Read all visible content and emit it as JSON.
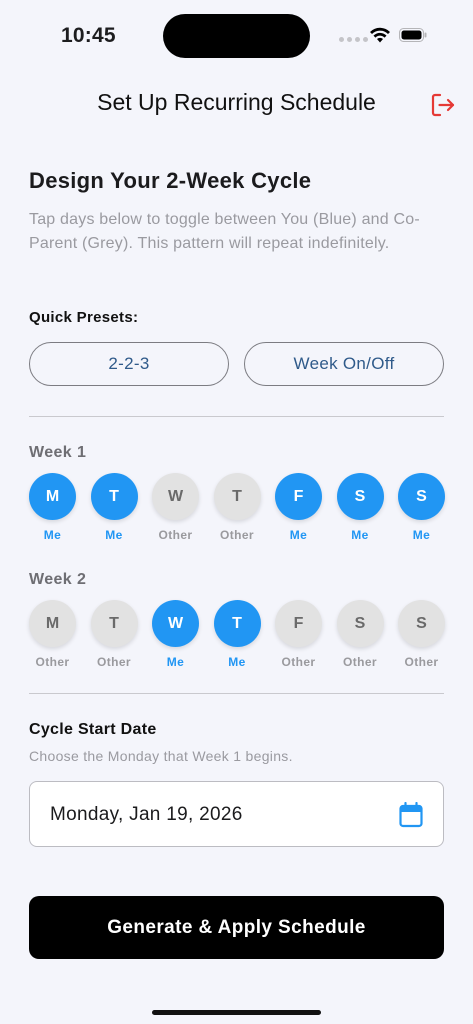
{
  "status_bar": {
    "time": "10:45"
  },
  "nav": {
    "title": "Set Up Recurring Schedule",
    "logout_icon": "logout-icon"
  },
  "intro": {
    "heading": "Design Your 2-Week Cycle",
    "description": "Tap days below to toggle between You (Blue) and Co-Parent (Grey). This pattern will repeat indefinitely."
  },
  "presets": {
    "label": "Quick Presets:",
    "options": [
      "2-2-3",
      "Week On/Off"
    ]
  },
  "weeks": [
    {
      "label": "Week 1",
      "days": [
        {
          "letter": "M",
          "owner": "Me"
        },
        {
          "letter": "T",
          "owner": "Me"
        },
        {
          "letter": "W",
          "owner": "Other"
        },
        {
          "letter": "T",
          "owner": "Other"
        },
        {
          "letter": "F",
          "owner": "Me"
        },
        {
          "letter": "S",
          "owner": "Me"
        },
        {
          "letter": "S",
          "owner": "Me"
        }
      ]
    },
    {
      "label": "Week 2",
      "days": [
        {
          "letter": "M",
          "owner": "Other"
        },
        {
          "letter": "T",
          "owner": "Other"
        },
        {
          "letter": "W",
          "owner": "Me"
        },
        {
          "letter": "T",
          "owner": "Me"
        },
        {
          "letter": "F",
          "owner": "Other"
        },
        {
          "letter": "S",
          "owner": "Other"
        },
        {
          "letter": "S",
          "owner": "Other"
        }
      ]
    }
  ],
  "cycle_start": {
    "label": "Cycle Start Date",
    "helper": "Choose the Monday that Week 1 begins.",
    "value": "Monday, Jan 19, 2026",
    "icon": "calendar-icon"
  },
  "action": {
    "label": "Generate & Apply Schedule"
  },
  "colors": {
    "accent": "#2196f3",
    "other": "#e2e2e2",
    "logout": "#e53935",
    "preset_text": "#2f5a8a",
    "background": "#f4f5fb"
  }
}
